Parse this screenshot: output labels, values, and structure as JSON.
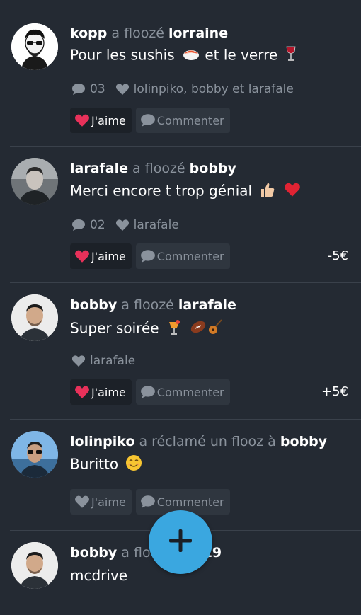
{
  "feed": [
    {
      "actor": "kopp",
      "verb": " a floozé ",
      "target": "lorraine",
      "message": "Pour les sushis",
      "message_mid": " et le verre",
      "comments_count": "03",
      "likers": "lolinpiko, bobby et larafale",
      "like_label": "J'aime",
      "comment_label": "Commenter",
      "amount": ""
    },
    {
      "actor": "larafale",
      "verb": " a floozé ",
      "target": "bobby",
      "message": "Merci encore t trop génial",
      "comments_count": "02",
      "likers": "larafale",
      "like_label": "J'aime",
      "comment_label": "Commenter",
      "amount": "-5€"
    },
    {
      "actor": "bobby",
      "verb": " a floozé ",
      "target": "larafale",
      "message": "Super soirée",
      "likers": "larafale",
      "like_label": "J'aime",
      "comment_label": "Commenter",
      "amount": "+5€"
    },
    {
      "actor": "lolinpiko",
      "verb": " a réclamé un flooz à ",
      "target": "bobby",
      "message": "Buritto",
      "like_label": "J'aime",
      "comment_label": "Commenter"
    },
    {
      "actor": "bobby",
      "verb": " a floo",
      "target": "i19",
      "message": "mcdrive"
    }
  ],
  "colors": {
    "background": "#242a33",
    "muted_text": "#8a929c",
    "heart_active": "#e8315a",
    "fab": "#3aa7e0"
  },
  "icons": {
    "comment": "speech-bubble-icon",
    "like": "heart-icon",
    "fab": "plus-icon"
  }
}
